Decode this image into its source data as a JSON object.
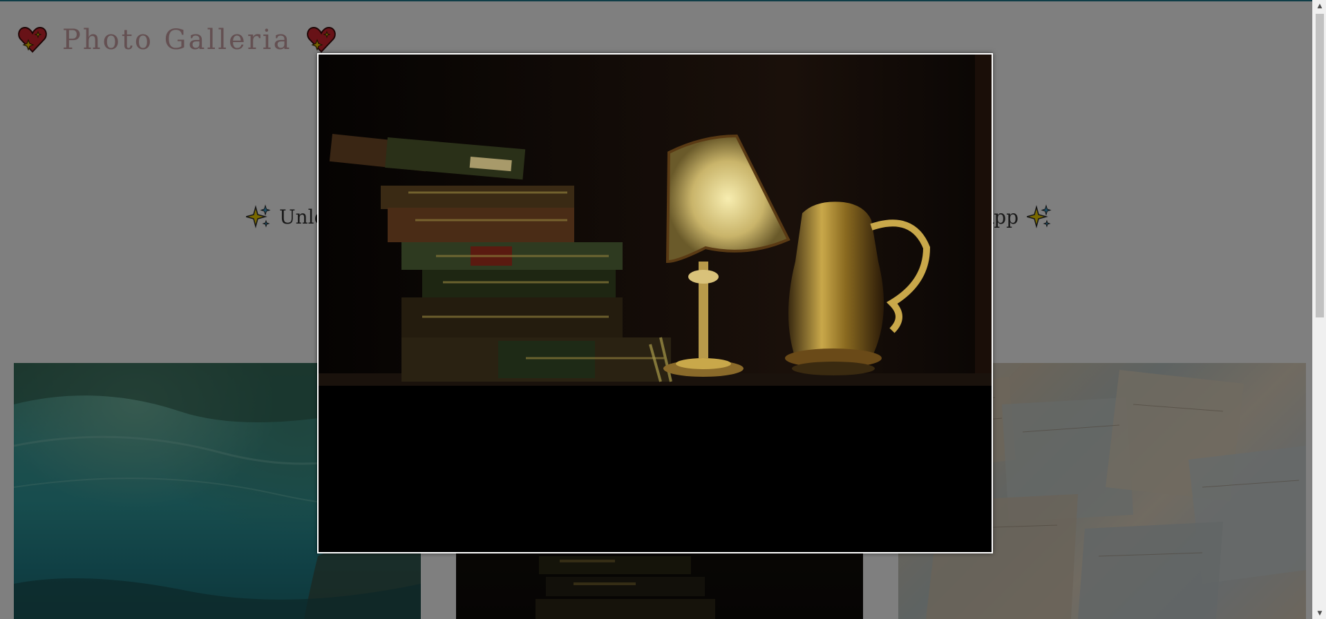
{
  "header": {
    "title": "Photo Galleria",
    "left_icon": "heart-icon",
    "right_icon": "heart-icon"
  },
  "tagline": {
    "text_left": "Unle",
    "text_right": "App",
    "icon": "sparkle-icon"
  },
  "gallery": {
    "tiles": [
      {
        "name": "sea-turtle-photo"
      },
      {
        "name": "books-lamp-photo"
      },
      {
        "name": "maps-photo"
      }
    ]
  },
  "modal": {
    "image": "books-lamp-photo",
    "open": true
  },
  "colors": {
    "accent": "#1e7b8f",
    "title": "#c8a0a4",
    "heart": "#d0242e",
    "sparkle": "#f2d200"
  }
}
